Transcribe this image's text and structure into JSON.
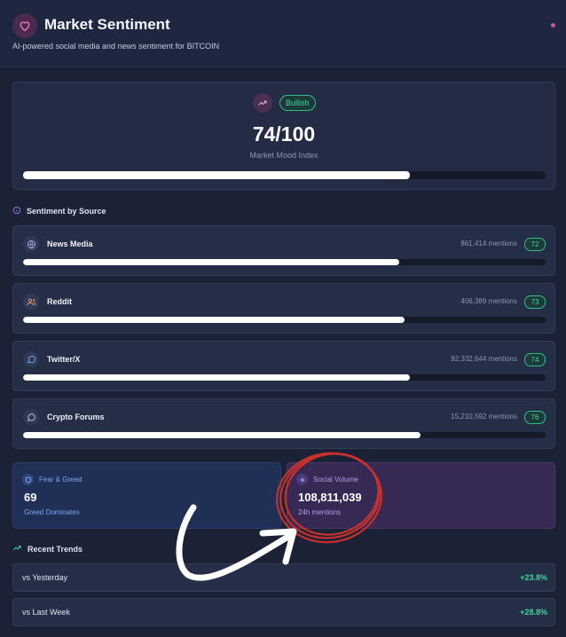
{
  "header": {
    "title": "Market Sentiment",
    "subtitle": "AI-powered social media and news sentiment for BITCOIN"
  },
  "mood": {
    "badge": "Bullish",
    "score_text": "74/100",
    "label": "Market Mood Index",
    "value": 74
  },
  "sources_section": {
    "title": "Sentiment by Source"
  },
  "sources": [
    {
      "name": "News Media",
      "mentions": "861,414 mentions",
      "score": "72",
      "value": 72,
      "icon": "globe-icon"
    },
    {
      "name": "Reddit",
      "mentions": "406,389 mentions",
      "score": "73",
      "value": 73,
      "icon": "users-icon"
    },
    {
      "name": "Twitter/X",
      "mentions": "92,332,644 mentions",
      "score": "74",
      "value": 74,
      "icon": "chat-bubble-icon"
    },
    {
      "name": "Crypto Forums",
      "mentions": "15,210,592 mentions",
      "score": "76",
      "value": 76,
      "icon": "message-circle-icon"
    }
  ],
  "fear_greed": {
    "title": "Fear & Greed",
    "value": "69",
    "subtitle": "Greed Dominates"
  },
  "social_volume": {
    "title": "Social Volume",
    "value": "108,811,039",
    "subtitle": "24h mentions"
  },
  "trends_section": {
    "title": "Recent Trends"
  },
  "trends": [
    {
      "label": "vs Yesterday",
      "value": "+23.8%"
    },
    {
      "label": "vs Last Week",
      "value": "+28.8%"
    }
  ],
  "colors": {
    "accent_green": "#3fd69a",
    "accent_pink": "#e06aa8",
    "accent_purple": "#a985f0",
    "accent_blue": "#5b8ef0",
    "annotation_red": "#c8302c"
  }
}
